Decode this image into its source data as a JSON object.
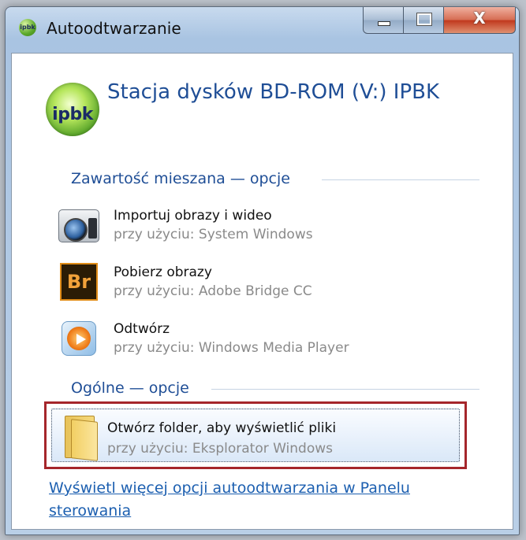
{
  "window": {
    "title": "Autoodtwarzanie",
    "app_icon_text": "ipbk",
    "controls": {
      "minimize": "minimize",
      "maximize": "maximize",
      "close_glyph": "X"
    }
  },
  "drive": {
    "icon_text": "ipbk",
    "title": "Stacja dysków BD-ROM (V:) IPBK"
  },
  "sections": {
    "mixed": "Zawartość mieszana — opcje",
    "general": "Ogólne — opcje"
  },
  "items": [
    {
      "icon": "camera-icon",
      "title": "Importuj obrazy i wideo",
      "subtitle": "przy użyciu: System Windows"
    },
    {
      "icon": "adobe-bridge-icon",
      "icon_text": "Br",
      "title": "Pobierz obrazy",
      "subtitle": "przy użyciu: Adobe Bridge CC"
    },
    {
      "icon": "windows-media-player-icon",
      "title": "Odtwórz",
      "subtitle": "przy użyciu: Windows Media Player"
    }
  ],
  "general_item": {
    "icon": "folder-icon",
    "title": "Otwórz folder, aby wyświetlić pliki",
    "subtitle": "przy użyciu: Eksplorator Windows"
  },
  "footer_link": "Wyświetl więcej opcji autoodtwarzania w Panelu sterowania",
  "colors": {
    "link": "#1c5fb0",
    "heading": "#1f4e96",
    "highlight_border": "#a5262b"
  }
}
